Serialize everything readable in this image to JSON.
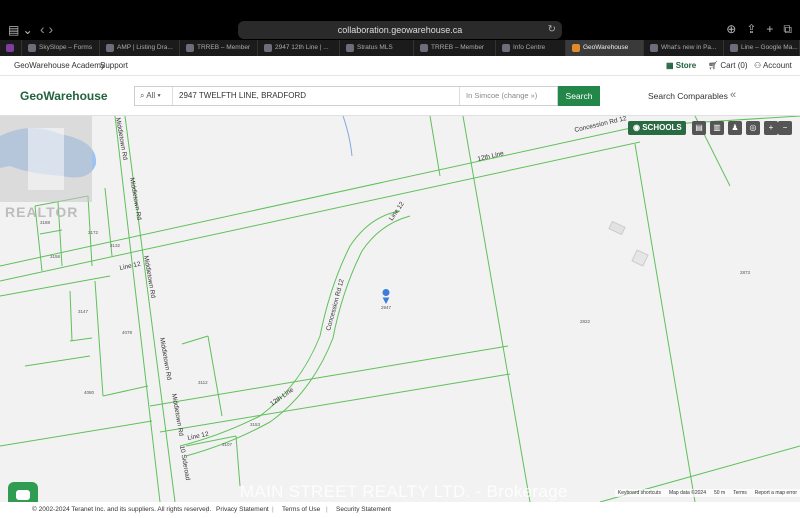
{
  "browser": {
    "url": "collaboration.geowarehouse.ca",
    "tabs": [
      {
        "label": "SkySlope – Forms"
      },
      {
        "label": "AMP | Listing Dra..."
      },
      {
        "label": "TRREB – Member"
      },
      {
        "label": "2947 12th Line | ..."
      },
      {
        "label": "Stratus MLS"
      },
      {
        "label": "TRREB – Member"
      },
      {
        "label": "Info Centre"
      },
      {
        "label": "GeoWarehouse"
      },
      {
        "label": "What's new in Pa..."
      },
      {
        "label": "Line – Google Ma..."
      }
    ]
  },
  "header": {
    "academy": "GeoWarehouse Academy",
    "support": "Support",
    "store": "Store",
    "cart": "Cart (0)",
    "account": "Account"
  },
  "search": {
    "logo": "GeoWarehouse",
    "scope": "All",
    "query": "2947  TWELFTH LINE, BRADFORD",
    "municipality": "In Simcoe",
    "change": "(change »)",
    "button": "Search",
    "comparables": "Search Comparables"
  },
  "map": {
    "schools": "SCHOOLS",
    "roads": {
      "concession": "Concession Rd 12",
      "twelfth_top": "12th Line",
      "line12_diag": "Line 12",
      "concession_curve": "Concession Rd 12",
      "twelfth_curve": "12th Line",
      "line12_left": "Line 12",
      "line12_bottom": "Line 12",
      "middletown1": "Middletown Rd",
      "middletown2": "Middletown Rd",
      "middletown3": "Middletown Rd",
      "middletown4": "Middletown Rd",
      "sideroad": "10 Sideroad"
    },
    "lots": [
      "3188",
      "3172",
      "3132",
      "3158",
      "3147",
      "4078",
      "3112",
      "4080",
      "3107",
      "2947",
      "2822",
      "2873",
      "3153"
    ],
    "attribution": [
      "Keyboard shortcuts",
      "Map data ©2024",
      "50 m",
      "Terms",
      "Report a map error"
    ]
  },
  "watermark": "MAIN STREET REALTY LTD. - Brokerage",
  "realtor_mark": "REALTOR",
  "footer": {
    "copyright": "© 2002-2024 Teranet Inc. and its suppliers. All rights reserved.",
    "privacy": "Privacy Statement",
    "terms": "Terms of Use",
    "security": "Security Statement"
  }
}
